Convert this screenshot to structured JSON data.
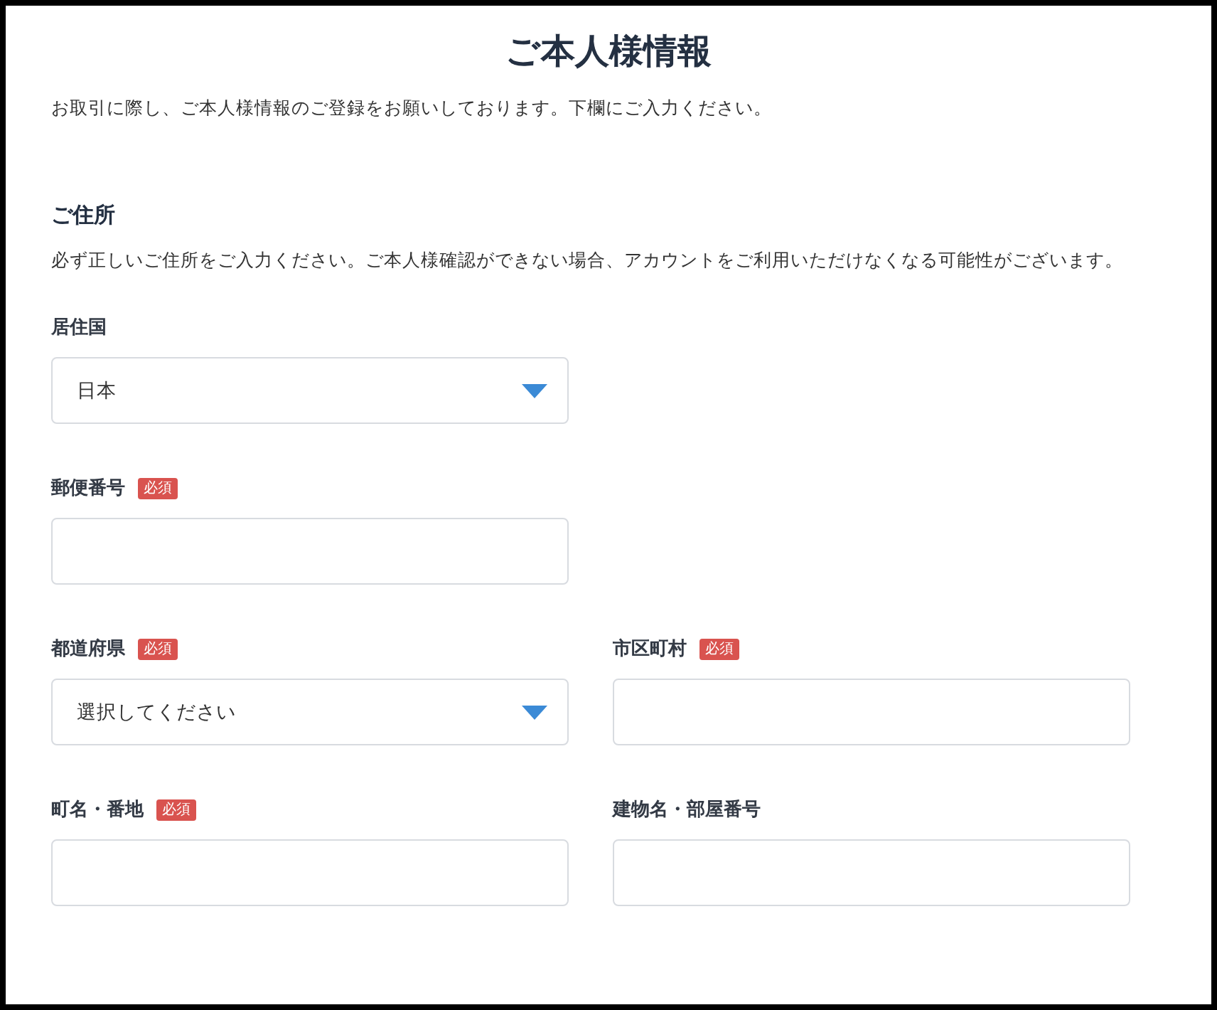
{
  "title": "ご本人様情報",
  "intro": "お取引に際し、ご本人様情報のご登録をお願いしております。下欄にご入力ください。",
  "section": {
    "heading": "ご住所",
    "description": "必ず正しいご住所をご入力ください。ご本人様確認ができない場合、アカウントをご利用いただけなくなる可能性がございます。"
  },
  "rows": [
    [
      {
        "kind": "select",
        "label": "居住国",
        "value": "日本"
      }
    ],
    [
      {
        "kind": "text",
        "label": "郵便番号",
        "badge": "必須"
      }
    ],
    [
      {
        "kind": "select",
        "label": "都道府県",
        "badge": "必須",
        "value": "選択してください"
      },
      {
        "kind": "text",
        "label": "市区町村",
        "badge": "必須"
      }
    ],
    [
      {
        "kind": "text",
        "label": "町名・番地",
        "badge": "必須"
      },
      {
        "kind": "text",
        "label": "建物名・部屋番号"
      }
    ]
  ]
}
